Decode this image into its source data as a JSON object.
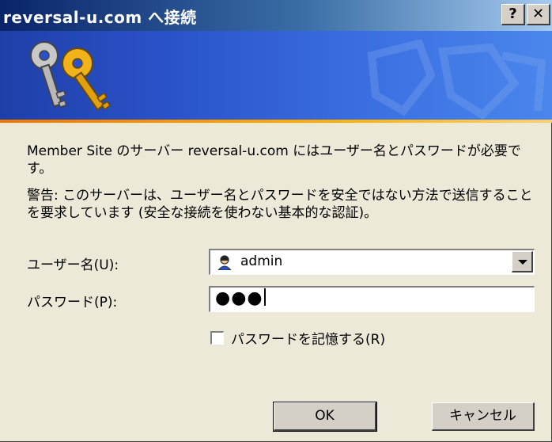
{
  "window": {
    "title": "reversal-u.com へ接続",
    "help_label": "?",
    "close_label": "✕"
  },
  "banner": {
    "icon": "keys-icon",
    "background_mark": "decorative-logo"
  },
  "message": {
    "line1": "Member Site のサーバー reversal-u.com にはユーザー名とパスワードが必要です。",
    "warning": "警告: このサーバーは、ユーザー名とパスワードを安全ではない方法で送信することを要求しています (安全な接続を使わない基本的な認証)。"
  },
  "form": {
    "username_label": "ユーザー名(U):",
    "username_value": "admin",
    "password_label": "パスワード(P):",
    "password_mask": "●●●",
    "remember_label": "パスワードを記憶する(R)",
    "remember_checked": false
  },
  "buttons": {
    "ok": "OK",
    "cancel": "キャンセル"
  },
  "colors": {
    "title_bar": "#0a246a",
    "banner": "#2a52c8",
    "accent_line": "#f07800",
    "dialog_bg": "#ece9d8"
  }
}
